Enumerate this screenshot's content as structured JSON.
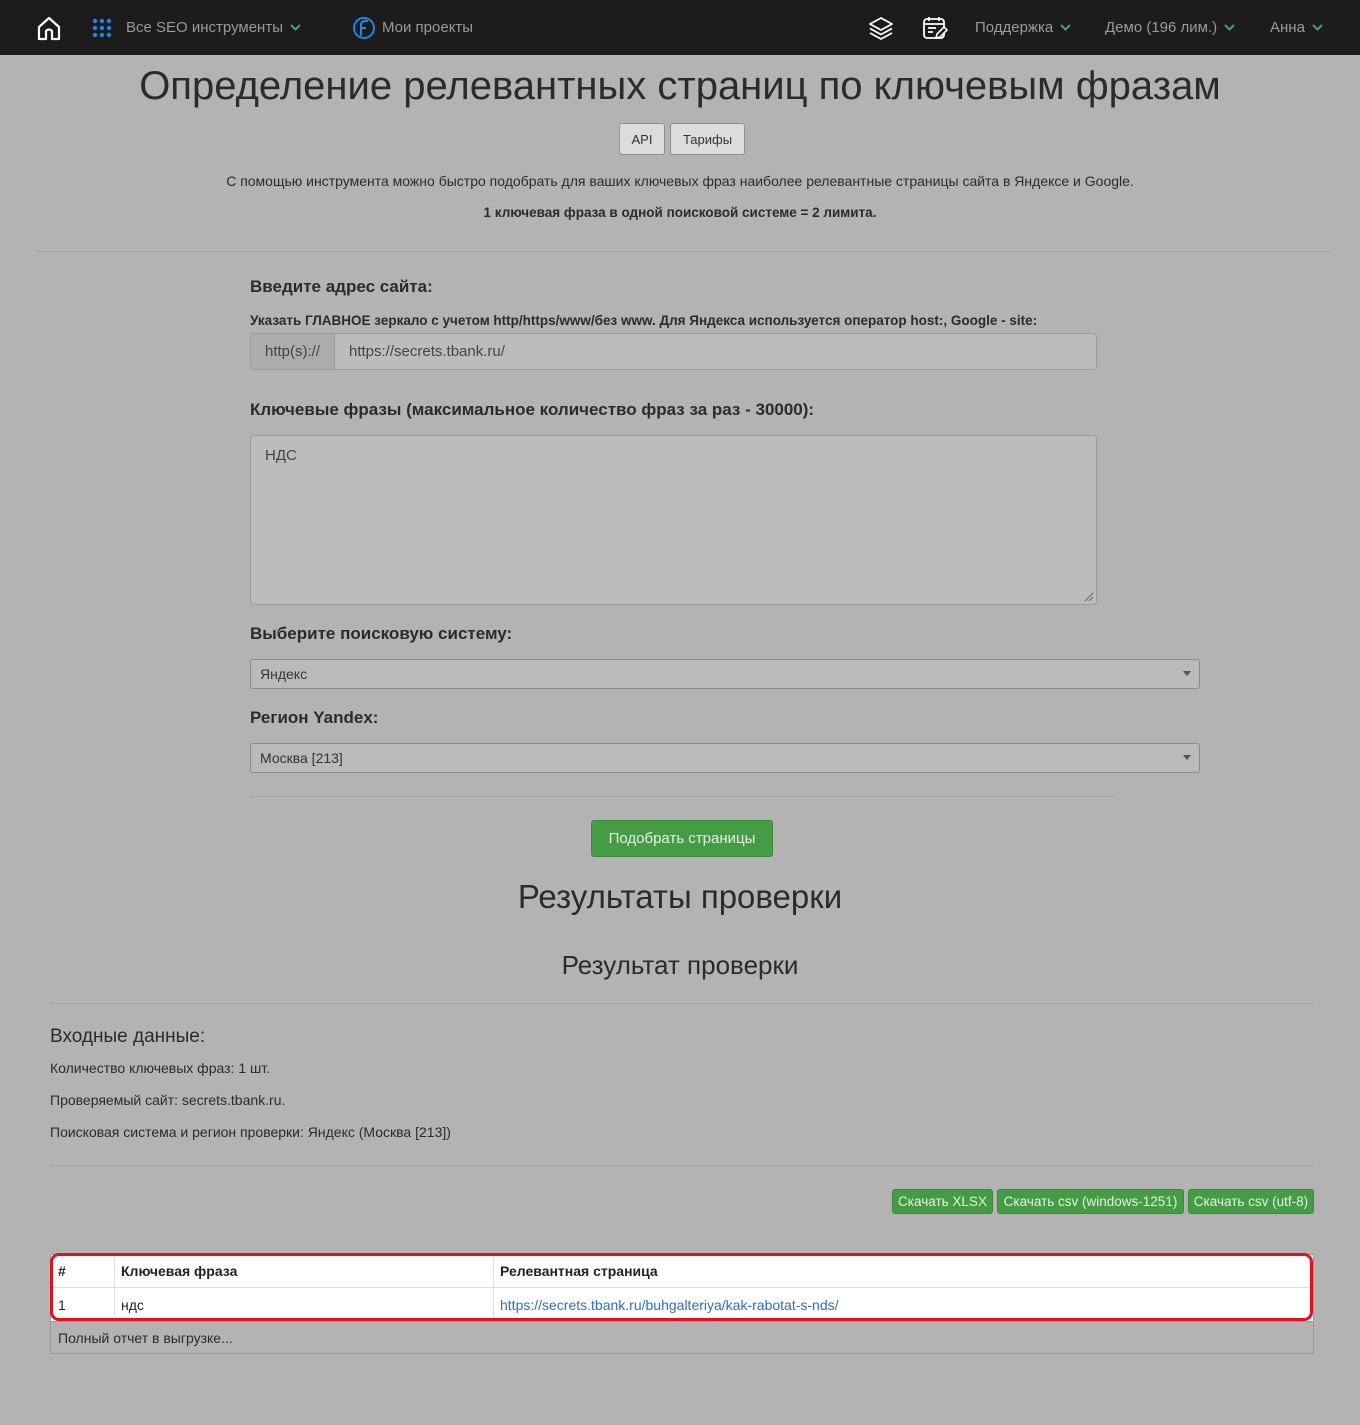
{
  "nav": {
    "tools_label": "Все SEO инструменты",
    "projects_label": "Мои проекты",
    "support_label": "Поддержка",
    "demo_label": "Демо (196 лим.)",
    "user_label": "Анна"
  },
  "header": {
    "title": "Определение релевантных страниц по ключевым фразам",
    "api_label": "API",
    "tariffs_label": "Тарифы",
    "description": "С помощью инструмента можно быстро подобрать для ваших ключевых фраз наиболее релевантные страницы сайта в Яндексе и Google.",
    "limit_note": "1 ключевая фраза в одной поисковой системе = 2 лимита."
  },
  "form": {
    "site_heading": "Введите адрес сайта:",
    "site_hint": "Указать ГЛАВНОЕ зеркало с учетом http/https/www/без www. Для Яндекса используется оператор host:, Google - site:",
    "site_prefix": "http(s)://",
    "site_value": "https://secrets.tbank.ru/",
    "keywords_heading": "Ключевые фразы (максимальное количество фраз за раз - 30000):",
    "keywords_value": "НДС",
    "engine_heading": "Выберите поисковую систему:",
    "engine_value": "Яндекс",
    "region_heading": "Регион Yandex:",
    "region_value": "Москва [213]",
    "submit_label": "Подобрать страницы"
  },
  "results": {
    "title": "Результаты проверки",
    "subtitle": "Результат проверки",
    "input_heading": "Входные данные:",
    "keyword_count": "Количество ключевых фраз: 1 шт.",
    "checked_site": "Проверяемый сайт: secrets.tbank.ru.",
    "engine_region": "Поисковая система и регион проверки: Яндекс (Москва [213])",
    "download_xlsx": "Скачать XLSX",
    "download_csv_1251": "Скачать csv (windows-1251)",
    "download_csv_utf8": "Скачать csv (utf-8)"
  },
  "table": {
    "headers": [
      "#",
      "Ключевая фраза",
      "Релевантная страница"
    ],
    "rows": [
      {
        "num": "1",
        "phrase": "ндс",
        "page": "https://secrets.tbank.ru/buhgalteriya/kak-rabotat-s-nds/"
      }
    ],
    "footer": "Полный отчет в выгрузке..."
  },
  "colors": {
    "navbar_bg": "#1d1b1b",
    "accent_green": "#449d44",
    "link_blue": "#2a6fc0",
    "highlight_red": "#e0121e"
  },
  "icons": [
    "home-icon",
    "grid-dots-icon",
    "projects-icon",
    "layers-icon",
    "calendar-edit-icon",
    "chevron-down-icon"
  ]
}
